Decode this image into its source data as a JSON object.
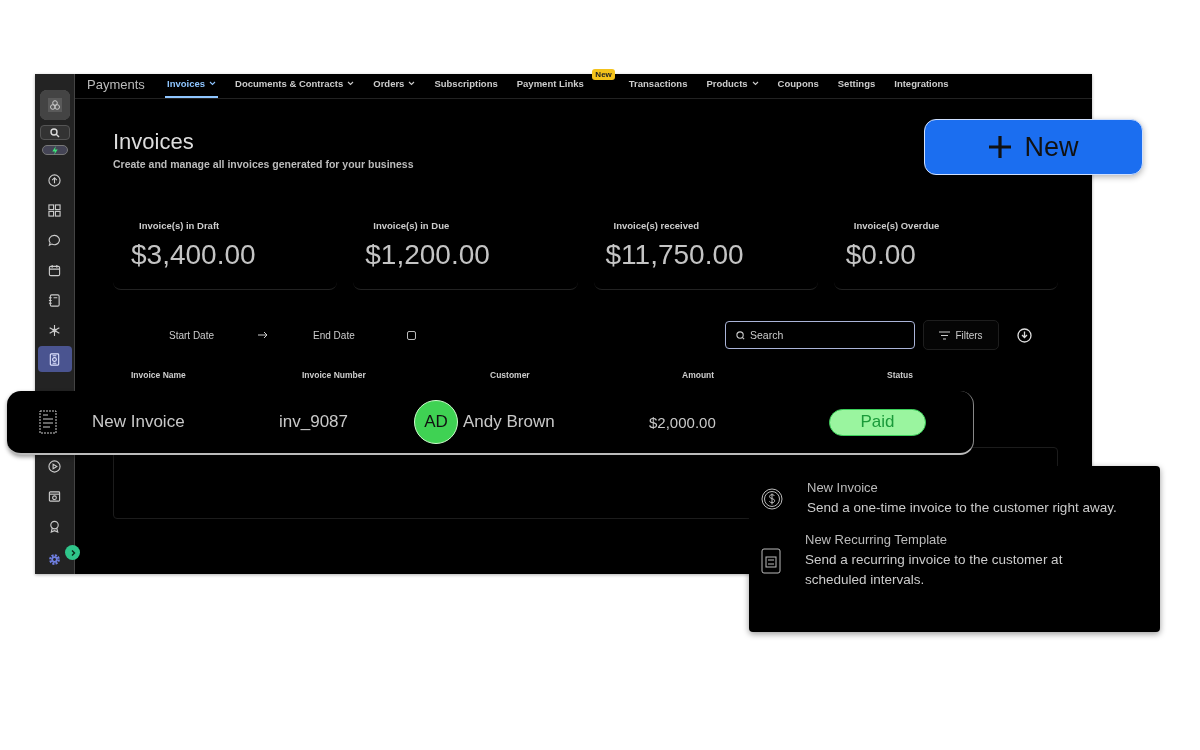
{
  "nav": {
    "title": "Payments",
    "tabs": [
      {
        "label": "Invoices",
        "selected": true,
        "dropdown": true
      },
      {
        "label": "Documents & Contracts",
        "selected": false,
        "dropdown": true
      },
      {
        "label": "Orders",
        "selected": false,
        "dropdown": true
      },
      {
        "label": "Subscriptions",
        "selected": false,
        "dropdown": false
      },
      {
        "label": "Payment Links",
        "selected": false,
        "dropdown": false,
        "badge": "New"
      },
      {
        "label": "Transactions",
        "selected": false,
        "dropdown": false
      },
      {
        "label": "Products",
        "selected": false,
        "dropdown": true
      },
      {
        "label": "Coupons",
        "selected": false,
        "dropdown": false
      },
      {
        "label": "Settings",
        "selected": false,
        "dropdown": false
      },
      {
        "label": "Integrations",
        "selected": false,
        "dropdown": false
      }
    ]
  },
  "sidebar": {
    "top_items": [
      {
        "selected": false
      },
      {
        "selected": false
      },
      {
        "selected": false
      },
      {
        "selected": false
      },
      {
        "selected": false
      },
      {
        "selected": false
      },
      {
        "selected": true
      }
    ],
    "bottom_items": [
      {
        "selected": false
      },
      {
        "selected": false
      },
      {
        "selected": false
      }
    ]
  },
  "page": {
    "title": "Invoices",
    "subtitle": "Create and manage all invoices generated for your business"
  },
  "new_button": {
    "label": "New"
  },
  "stats": [
    {
      "label": "Invoice(s) in Draft",
      "value": "$3,400.00"
    },
    {
      "label": "Invoice(s) in Due",
      "value": "$1,200.00"
    },
    {
      "label": "Invoice(s) received",
      "value": "$11,750.00"
    },
    {
      "label": "Invoice(s) Overdue",
      "value": "$0.00"
    }
  ],
  "filters": {
    "start_date": "Start Date",
    "end_date": "End Date",
    "search": {
      "placeholder": "Search"
    },
    "filters_button": "Filters"
  },
  "table": {
    "columns": [
      "Invoice Name",
      "Invoice Number",
      "Customer",
      "Amount",
      "Status"
    ],
    "rows": [
      {
        "name": "New Invoice",
        "number": "inv_9087",
        "initials": "AD",
        "customer": "Andy Brown",
        "amount": "$2,000.00",
        "status": {
          "label": "Paid",
          "kind": "paid"
        }
      }
    ]
  },
  "new_menu": {
    "items": [
      {
        "kind": "one-time",
        "title": "New Invoice",
        "description": "Send a one-time invoice to the customer right away."
      },
      {
        "kind": "recurring",
        "title": "New Recurring Template",
        "description": "Send a recurring invoice to the customer at scheduled intervals."
      }
    ]
  }
}
